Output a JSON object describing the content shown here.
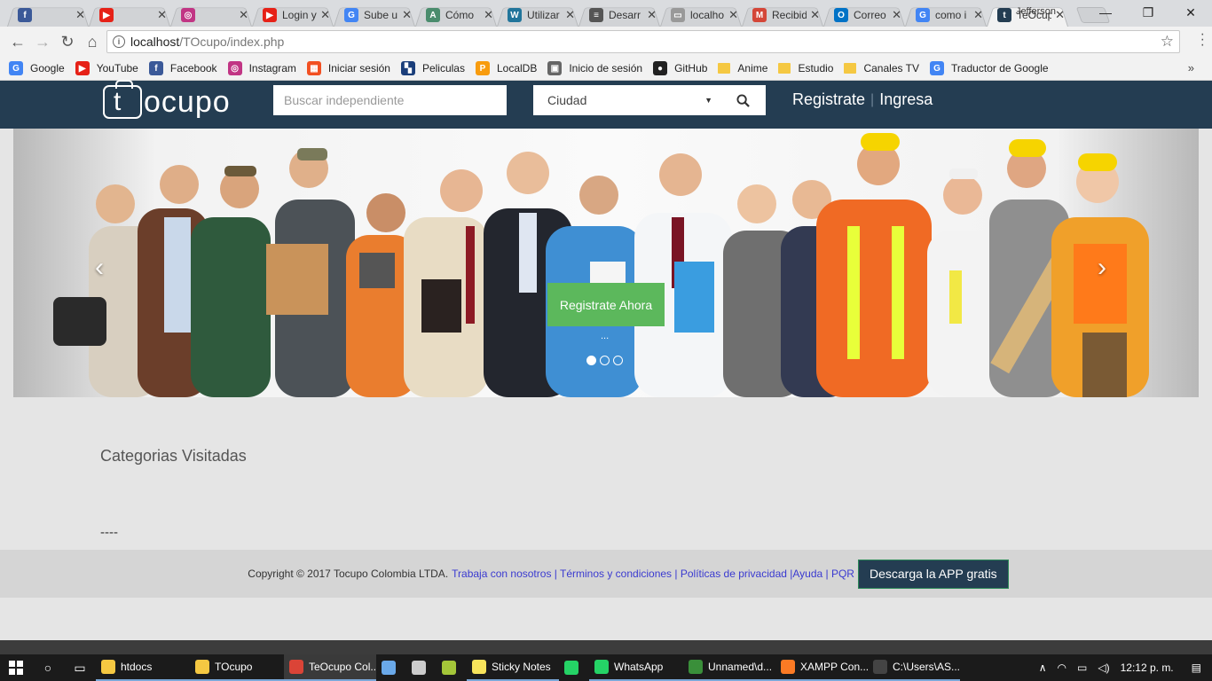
{
  "browser": {
    "tabs": [
      {
        "title": "",
        "icon": "facebook-icon",
        "color": "#3b5998",
        "glyph": "f"
      },
      {
        "title": "",
        "icon": "youtube-icon",
        "color": "#e62117",
        "glyph": "▶"
      },
      {
        "title": "",
        "icon": "instagram-icon",
        "color": "#c13584",
        "glyph": "◎"
      },
      {
        "title": "Login y",
        "icon": "youtube-icon",
        "color": "#e62117",
        "glyph": "▶"
      },
      {
        "title": "Sube u",
        "icon": "google-icon",
        "color": "#4285f4",
        "glyph": "G"
      },
      {
        "title": "Cómo",
        "icon": "android-studio-icon",
        "color": "#4a8c6d",
        "glyph": "A"
      },
      {
        "title": "Utilizar",
        "icon": "wordpress-icon",
        "color": "#21759b",
        "glyph": "W"
      },
      {
        "title": "Desarr",
        "icon": "dev-icon",
        "color": "#555555",
        "glyph": "≡"
      },
      {
        "title": "localho",
        "icon": "localhost-icon",
        "color": "#999999",
        "glyph": "▭"
      },
      {
        "title": "Recibid",
        "icon": "gmail-icon",
        "color": "#d44638",
        "glyph": "M"
      },
      {
        "title": "Correo",
        "icon": "outlook-icon",
        "color": "#0072c6",
        "glyph": "O"
      },
      {
        "title": "como i",
        "icon": "google-icon",
        "color": "#4285f4",
        "glyph": "G"
      },
      {
        "title": "TeOcup",
        "icon": "tocupo-icon",
        "color": "#243d52",
        "glyph": "t",
        "active": true
      }
    ],
    "user": "Jefferson",
    "url_host": "localhost",
    "url_path": "/TOcupo/index.php"
  },
  "bookmarks": [
    {
      "label": "Google",
      "icon": "google-icon",
      "color": "#4285f4",
      "glyph": "G"
    },
    {
      "label": "YouTube",
      "icon": "youtube-icon",
      "color": "#e62117",
      "glyph": "▶"
    },
    {
      "label": "Facebook",
      "icon": "facebook-icon",
      "color": "#3b5998",
      "glyph": "f"
    },
    {
      "label": "Instagram",
      "icon": "instagram-icon",
      "color": "#c13584",
      "glyph": "◎"
    },
    {
      "label": "Iniciar sesión",
      "icon": "microsoft-icon",
      "color": "#f25022",
      "glyph": "▦"
    },
    {
      "label": "Peliculas",
      "icon": "clapper-icon",
      "color": "#1a3e7a",
      "glyph": "▚"
    },
    {
      "label": "LocalDB",
      "icon": "phpmyadmin-icon",
      "color": "#f89c0e",
      "glyph": "P"
    },
    {
      "label": "Inicio de sesión",
      "icon": "image-icon",
      "color": "#666666",
      "glyph": "▣"
    },
    {
      "label": "GitHub",
      "icon": "github-icon",
      "color": "#222222",
      "glyph": "●"
    },
    {
      "label": "Anime",
      "icon": "folder-icon",
      "color": "#f5c842",
      "glyph": ""
    },
    {
      "label": "Estudio",
      "icon": "folder-icon",
      "color": "#f5c842",
      "glyph": ""
    },
    {
      "label": "Canales TV",
      "icon": "folder-icon",
      "color": "#f5c842",
      "glyph": ""
    },
    {
      "label": "Traductor de Google",
      "icon": "translate-icon",
      "color": "#4285f4",
      "glyph": "G"
    }
  ],
  "site": {
    "logo_letter": "t",
    "logo_text": "ocupo",
    "search_placeholder": "Buscar independiente",
    "city_label": "Ciudad",
    "register_link": "Registrate",
    "login_link": "Ingresa",
    "header_color": "#243d52"
  },
  "carousel": {
    "cta_label": "Registrate Ahora",
    "cta_sub": "...",
    "slides": 3,
    "active_slide": 1,
    "prev_glyph": "‹",
    "next_glyph": "›"
  },
  "content": {
    "categories_title": "Categorias Visitadas",
    "dashes": "----"
  },
  "footer": {
    "copyright": "Copyright © 2017 Tocupo Colombia LTDA.",
    "links_text": "Trabaja con nosotros | Términos y condiciones | Políticas de privacidad |Ayuda | PQR",
    "app_button": "Descarga la APP gratis"
  },
  "taskbar": {
    "apps": [
      {
        "label": "htdocs",
        "icon": "folder-icon",
        "color": "#f5c842"
      },
      {
        "label": "TOcupo",
        "icon": "folder-icon",
        "color": "#f5c842"
      },
      {
        "label": "TeOcupo Col...",
        "icon": "chrome-icon",
        "color": "#db4437",
        "active": true
      },
      {
        "label": "",
        "icon": "virtualbox-icon",
        "color": "#6aa9e9"
      },
      {
        "label": "",
        "icon": "network-icon",
        "color": "#cccccc"
      },
      {
        "label": "",
        "icon": "android-icon",
        "color": "#a4c639"
      },
      {
        "label": "Sticky Notes",
        "icon": "sticky-notes-icon",
        "color": "#f7e35b"
      },
      {
        "label": "",
        "icon": "whatsapp-icon",
        "color": "#25d366"
      },
      {
        "label": "WhatsApp",
        "icon": "whatsapp-icon",
        "color": "#25d366"
      },
      {
        "label": "Unnamed\\d...",
        "icon": "heidisql-icon",
        "color": "#3a8f3a"
      },
      {
        "label": "XAMPP Con...",
        "icon": "xampp-icon",
        "color": "#fb7a24"
      },
      {
        "label": "C:\\Users\\AS...",
        "icon": "cmd-icon",
        "color": "#444444"
      }
    ],
    "clock": "12:12 p. m."
  }
}
